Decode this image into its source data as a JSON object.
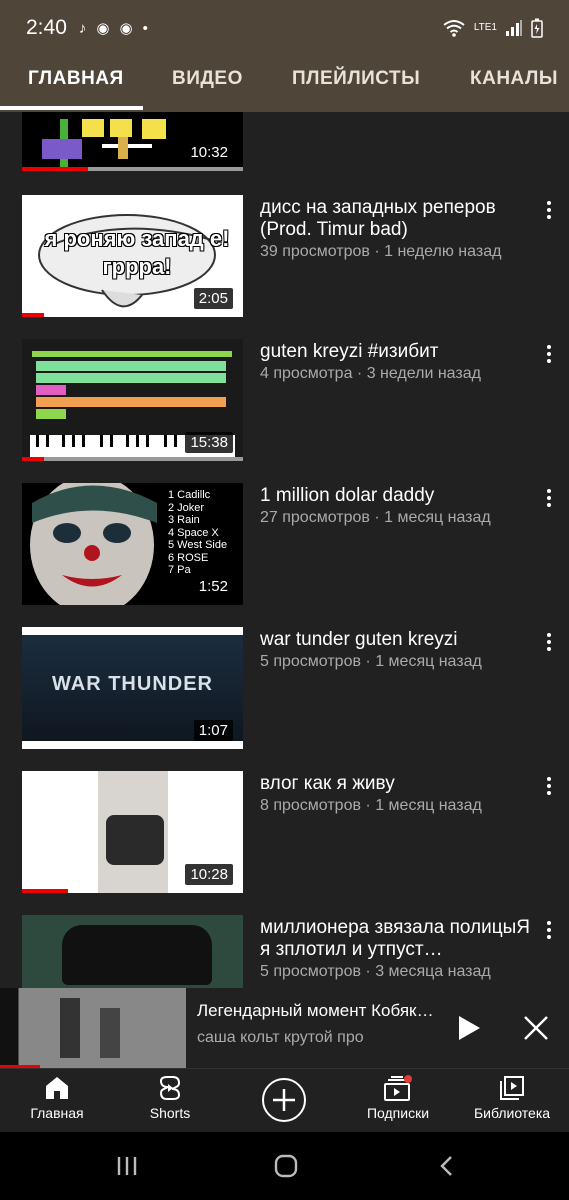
{
  "status": {
    "time": "2:40",
    "network": "LTE1"
  },
  "tabs": [
    {
      "label": "ГЛАВНАЯ"
    },
    {
      "label": "ВИДЕО"
    },
    {
      "label": "ПЛЕЙЛИСТЫ"
    },
    {
      "label": "КАНАЛЫ"
    }
  ],
  "videos": [
    {
      "duration": "10:32",
      "progress": 0.3
    },
    {
      "title": "дисс на западных реперов (Prod. Timur bad)",
      "meta": "39 просмотров · 1 неделю назад",
      "duration": "2:05",
      "thumb_text": "я роняю запад е! грррa!",
      "progress": 0.1
    },
    {
      "title": "guten kreyzi #изибит",
      "meta": "4 просмотра · 3 недели назад",
      "duration": "15:38",
      "progress": 0.1
    },
    {
      "title": "1 million dolar daddy",
      "meta": "27 просмотров · 1 месяц назад",
      "duration": "1:52",
      "tracklist": [
        "1 Cadillc",
        "2 Joker",
        "3 Rain",
        "4 Space X",
        "5 West Side",
        "6 ROSE",
        "7 Pa"
      ]
    },
    {
      "title": "war tunder guten kreyzi",
      "meta": "5 просмотров · 1 месяц назад",
      "duration": "1:07",
      "thumb_text": "WAR THUNDER"
    },
    {
      "title": "влог как я живу",
      "meta": "8 просмотров · 1 месяц назад",
      "duration": "10:28",
      "progress": 0.21
    },
    {
      "title": "миллионера звязала полицыЯ я зплотил и утпуст…",
      "meta": "5 просмотров · 3 месяца назад"
    }
  ],
  "miniplayer": {
    "title": "Легендарный момент Кобяко…",
    "channel": "саша кольт крутой про"
  },
  "bottom_nav": [
    {
      "label": "Главная"
    },
    {
      "label": "Shorts"
    },
    {
      "label": ""
    },
    {
      "label": "Подписки"
    },
    {
      "label": "Библиотека"
    }
  ]
}
